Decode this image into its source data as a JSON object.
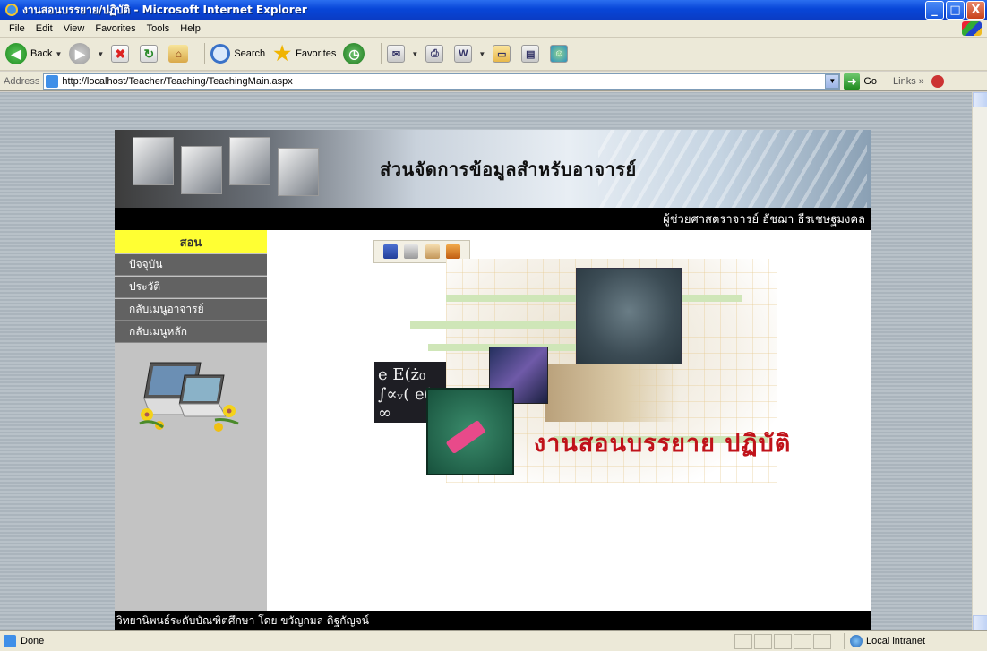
{
  "window": {
    "title": "งานสอนบรรยาย/ปฏิบัติ - Microsoft Internet Explorer",
    "buttons": {
      "minimize": "_",
      "maximize": "□",
      "close": "X"
    }
  },
  "menu": [
    "File",
    "Edit",
    "View",
    "Favorites",
    "Tools",
    "Help"
  ],
  "toolbar": {
    "back_label": "Back",
    "search_label": "Search",
    "favorites_label": "Favorites"
  },
  "address": {
    "label": "Address",
    "url": "http://localhost/Teacher/Teaching/TeachingMain.aspx",
    "go_label": "Go",
    "links_label": "Links"
  },
  "page": {
    "banner_title": "ส่วนจัดการข้อมูลสำหรับอาจารย์",
    "user_name": "ผู้ช่วยศาสตราจารย์ อัชฌา ธีรเชษฐมงคล",
    "sidebar": {
      "header": "สอน",
      "items": [
        {
          "label": "ปัจจุบัน"
        },
        {
          "label": "ประวัติ"
        },
        {
          "label": "กลับเมนูอาจารย์"
        },
        {
          "label": "กลับเมนูหลัก"
        }
      ]
    },
    "hero_title": "งานสอนบรรยาย ปฏิบัติ",
    "chalk_text": "e E(ż₀ ∫∝ᵥ( e(- ∞",
    "footer": "วิทยานิพนธ์ระดับบัณฑิตศึกษา โดย ขวัญกมล ดิฐกัญจน์"
  },
  "status": {
    "text": "Done",
    "zone": "Local intranet"
  },
  "colors": {
    "sidebar_header": "#ffff33",
    "sidebar_item": "#626262",
    "hero_title": "#c0121a",
    "title_bar": "#0846d8"
  }
}
